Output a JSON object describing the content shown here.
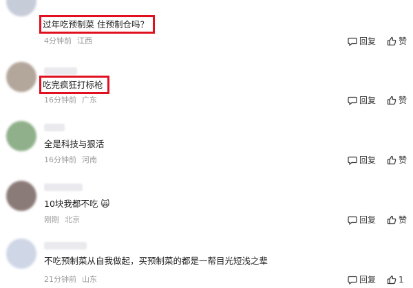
{
  "comments": [
    {
      "text": "过年吃预制菜 住预制仓吗？",
      "time": "4分钟前",
      "location": "江西",
      "reply_label": "回复",
      "like_label": "赞",
      "avatar_color": "#c7ccd9",
      "highlighted": true
    },
    {
      "text": "吃完疯狂打标枪",
      "time": "16分钟前",
      "location": "广东",
      "reply_label": "回复",
      "like_label": "赞",
      "avatar_color": "#b3a69a",
      "highlighted": true
    },
    {
      "text": "全是科技与狠活",
      "time": "16分钟前",
      "location": "河南",
      "reply_label": "回复",
      "like_label": "赞",
      "avatar_color": "#8fb08a",
      "highlighted": false
    },
    {
      "text": "10块我都不吃 🙀",
      "time": "刚刚",
      "location": "北京",
      "reply_label": "回复",
      "like_label": "赞",
      "avatar_color": "#8a7b78",
      "highlighted": false
    },
    {
      "text": "不吃预制菜从自我做起，买预制菜的都是一帮目光短浅之辈",
      "time": "21分钟前",
      "location": "山东",
      "reply_label": "回复",
      "like_label": "1",
      "avatar_color": "#cfd6e6",
      "highlighted": false
    }
  ],
  "colors": {
    "highlight_border": "#e0101e",
    "meta_text": "#9a9a9a"
  },
  "icons": {
    "reply": "comment-bubble-icon",
    "like": "thumbs-up-icon"
  }
}
